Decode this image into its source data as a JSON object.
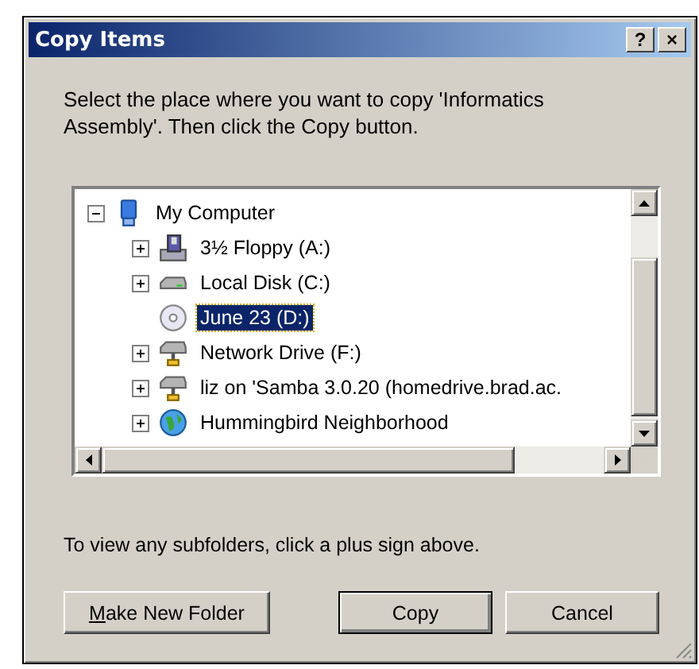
{
  "window": {
    "title": "Copy Items",
    "title_buttons": [
      "?",
      "×"
    ]
  },
  "instruction": "Select the place where you want to copy 'Informatics Assembly'. Then click the Copy button.",
  "tree": [
    {
      "label": "My Computer",
      "kind": "computer",
      "expanded": true,
      "selected": false,
      "children": [
        {
          "label": "3½ Floppy (A:)",
          "kind": "floppy",
          "expanded": false,
          "selected": false
        },
        {
          "label": "Local Disk (C:)",
          "kind": "disk",
          "expanded": false,
          "selected": false
        },
        {
          "label": "June 23 (D:)",
          "kind": "cd",
          "selected": true
        },
        {
          "label": "Network Drive (F:)",
          "kind": "network",
          "expanded": false,
          "selected": false
        },
        {
          "label": "liz on 'Samba 3.0.20 (homedrive.brad.ac.",
          "kind": "network",
          "expanded": false,
          "selected": false
        },
        {
          "label": "Hummingbird Neighborhood",
          "kind": "neighborhood",
          "expanded": false,
          "selected": false
        }
      ]
    }
  ],
  "hint": "To view any subfolders, click a plus sign above.",
  "buttons": [
    {
      "label": "Make New Folder",
      "key_underlined": true,
      "default": false
    },
    {
      "label": "Copy",
      "key_underlined": false,
      "default": true
    },
    {
      "label": "Cancel",
      "key_underlined": false,
      "default": false
    }
  ]
}
